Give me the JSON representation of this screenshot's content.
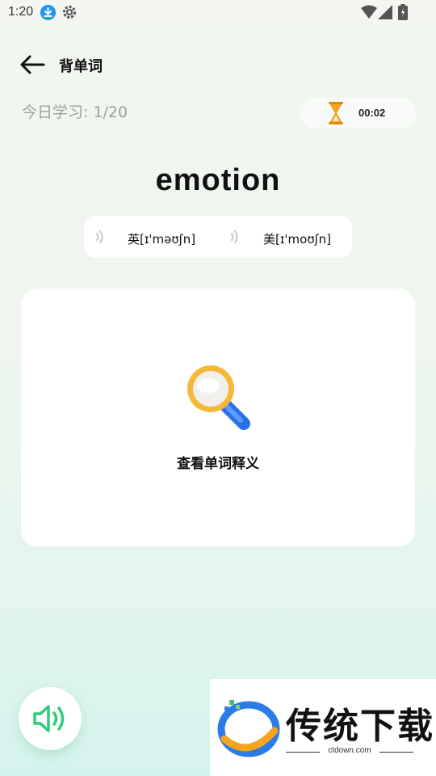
{
  "status_bar": {
    "time": "1:20"
  },
  "header": {
    "title": "背单词"
  },
  "progress": {
    "label": "今日学习: 1/20"
  },
  "timer": {
    "value": "00:02"
  },
  "word": {
    "text": "emotion"
  },
  "phonetics": {
    "uk": "英[ɪ'məʊʃn]",
    "us": "美[ɪ'moʊʃn]"
  },
  "definition": {
    "reveal_label": "查看单词释义"
  },
  "watermark": {
    "title": "传统下载",
    "subtitle": "ctdown.com"
  },
  "colors": {
    "accent_green": "#2ecb7a",
    "timer_orange": "#f3a51d",
    "magnifier_blue": "#2a6fe6"
  }
}
